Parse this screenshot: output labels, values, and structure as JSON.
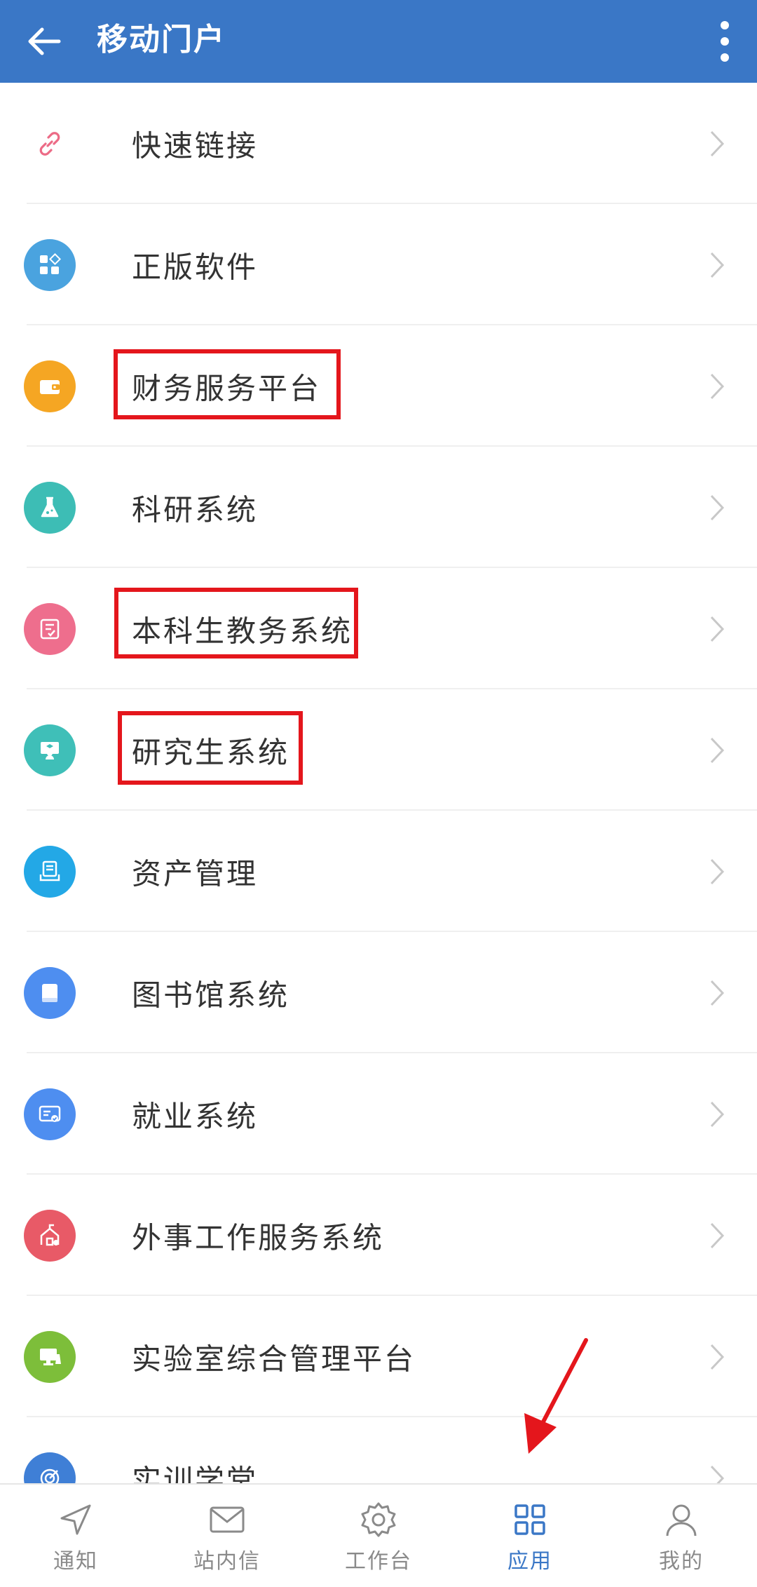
{
  "header": {
    "title": "移动门户"
  },
  "menu": [
    {
      "label": "快速链接",
      "icon": "link-icon",
      "color": "#ffffff",
      "highlighted": false
    },
    {
      "label": "正版软件",
      "icon": "apps-icon",
      "color": "#4aa3df",
      "highlighted": false
    },
    {
      "label": "财务服务平台",
      "icon": "wallet-icon",
      "color": "#f5a623",
      "highlighted": true
    },
    {
      "label": "科研系统",
      "icon": "flask-icon",
      "color": "#3dbdb5",
      "highlighted": false
    },
    {
      "label": "本科生教务系统",
      "icon": "document-icon",
      "color": "#ee6e8d",
      "highlighted": true
    },
    {
      "label": "研究生系统",
      "icon": "presentation-icon",
      "color": "#3fbfb8",
      "highlighted": true
    },
    {
      "label": "资产管理",
      "icon": "archive-icon",
      "color": "#23a8e6",
      "highlighted": false
    },
    {
      "label": "图书馆系统",
      "icon": "book-icon",
      "color": "#4e8ef0",
      "highlighted": false
    },
    {
      "label": "就业系统",
      "icon": "certificate-icon",
      "color": "#4e8ef0",
      "highlighted": false
    },
    {
      "label": "外事工作服务系统",
      "icon": "building-icon",
      "color": "#e85a67",
      "highlighted": false
    },
    {
      "label": "实验室综合管理平台",
      "icon": "monitor-icon",
      "color": "#7dbe3a",
      "highlighted": false
    },
    {
      "label": "实训学堂",
      "icon": "target-icon",
      "color": "#3f7fd6",
      "highlighted": false
    }
  ],
  "tabs": [
    {
      "label": "通知",
      "icon": "send-icon",
      "active": false
    },
    {
      "label": "站内信",
      "icon": "mail-icon",
      "active": false
    },
    {
      "label": "工作台",
      "icon": "gear-icon",
      "active": false
    },
    {
      "label": "应用",
      "icon": "grid-icon",
      "active": true
    },
    {
      "label": "我的",
      "icon": "user-icon",
      "active": false
    }
  ],
  "colors": {
    "primary": "#3a77c6",
    "highlight": "#e4161c",
    "tab_inactive": "#8a8a8a"
  }
}
